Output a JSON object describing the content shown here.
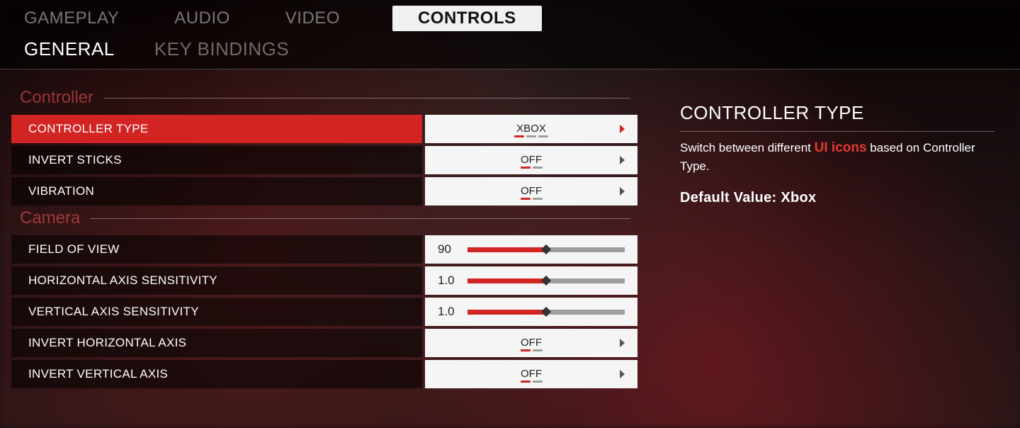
{
  "tabs_primary": {
    "items": [
      "GAMEPLAY",
      "AUDIO",
      "VIDEO",
      "CONTROLS"
    ],
    "active_index": 3
  },
  "tabs_secondary": {
    "items": [
      "GENERAL",
      "KEY BINDINGS"
    ],
    "active_index": 0
  },
  "sections": [
    {
      "title": "Controller",
      "settings": [
        {
          "key": "controller_type",
          "label": "CONTROLLER TYPE",
          "type": "enum",
          "value": "XBOX",
          "option_count": 3,
          "option_index": 0,
          "selected": true
        },
        {
          "key": "invert_sticks",
          "label": "INVERT STICKS",
          "type": "enum",
          "value": "OFF",
          "option_count": 2,
          "option_index": 0,
          "selected": false
        },
        {
          "key": "vibration",
          "label": "VIBRATION",
          "type": "enum",
          "value": "OFF",
          "option_count": 2,
          "option_index": 0,
          "selected": false
        }
      ]
    },
    {
      "title": "Camera",
      "settings": [
        {
          "key": "fov",
          "label": "FIELD OF VIEW",
          "type": "slider",
          "value": "90",
          "fill_percent": 50,
          "selected": false
        },
        {
          "key": "h_sens",
          "label": "HORIZONTAL AXIS SENSITIVITY",
          "type": "slider",
          "value": "1.0",
          "fill_percent": 50,
          "selected": false
        },
        {
          "key": "v_sens",
          "label": "VERTICAL AXIS SENSITIVITY",
          "type": "slider",
          "value": "1.0",
          "fill_percent": 50,
          "selected": false
        },
        {
          "key": "invert_h",
          "label": "INVERT HORIZONTAL AXIS",
          "type": "enum",
          "value": "OFF",
          "option_count": 2,
          "option_index": 0,
          "selected": false
        },
        {
          "key": "invert_v",
          "label": "INVERT VERTICAL AXIS",
          "type": "enum",
          "value": "OFF",
          "option_count": 2,
          "option_index": 0,
          "selected": false
        }
      ]
    }
  ],
  "detail": {
    "title": "CONTROLLER TYPE",
    "desc_prefix": "Switch between different ",
    "desc_highlight": "UI icons",
    "desc_suffix": " based on Controller Type.",
    "default_label": "Default Value: ",
    "default_value": "Xbox"
  }
}
